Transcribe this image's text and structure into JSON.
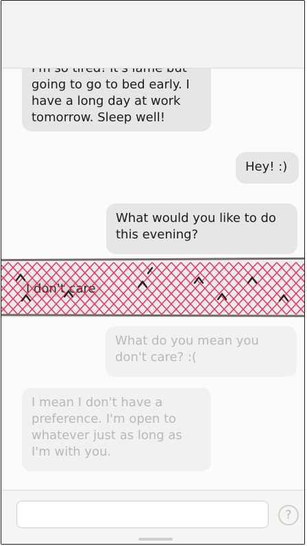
{
  "messages": [
    {
      "id": "m1",
      "side": "left",
      "text": "I'm so tired! It's lame but going to go to bed early. I have a long day at work tomorrow. Sleep well!"
    },
    {
      "id": "m2",
      "side": "right",
      "text": "Hey! :)"
    },
    {
      "id": "m3",
      "side": "right",
      "text": "What would you like to do this evening?"
    },
    {
      "id": "m4",
      "side": "left",
      "text": "I don't care",
      "scribbled": true
    },
    {
      "id": "m5",
      "side": "right",
      "text": "What do you mean you don't care? :(",
      "faded": true
    },
    {
      "id": "m6",
      "side": "left",
      "text": "I mean I don't have a preference. I'm open to whatever just as long as I'm with you.",
      "faded": true
    }
  ],
  "composer": {
    "value": "",
    "help_label": "?"
  },
  "icons": {
    "help": "question-circle-icon"
  },
  "colors": {
    "scribble": "#e8184f",
    "bubble": "#e6e6e4",
    "faded_text": "#b8b8b8"
  }
}
